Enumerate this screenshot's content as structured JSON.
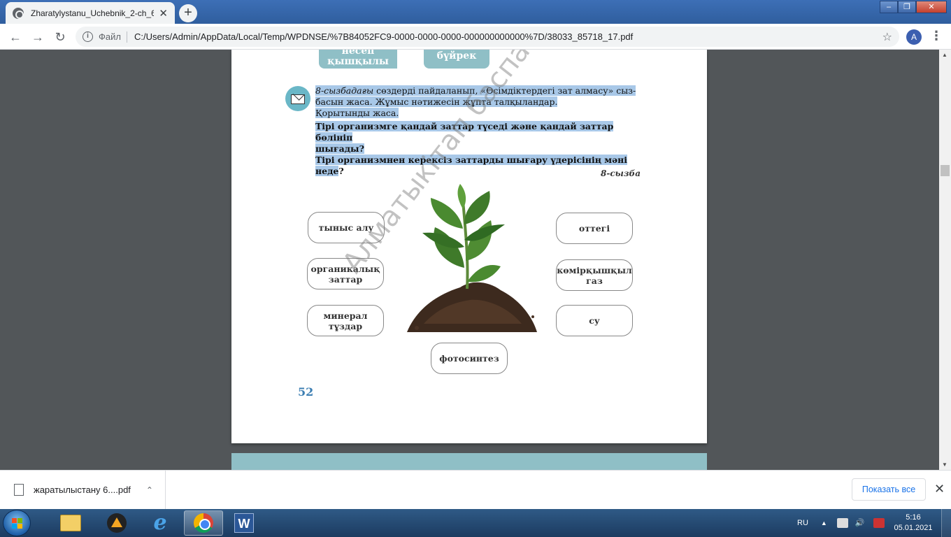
{
  "browser": {
    "tab_title": "Zharatylystanu_Uchebnik_2-ch_6",
    "tab_close": "✕",
    "new_tab": "+",
    "scheme_label": "Файл",
    "url": "C:/Users/Admin/AppData/Local/Temp/WPDNSE/%7B84052FC9-0000-0000-0000-000000000000%7D/38033_85718_17.pdf",
    "profile_initial": "A",
    "star_icon": "☆",
    "menu_icon": "⋮",
    "back_icon": "←",
    "forward_icon": "→",
    "reload_icon": "↻"
  },
  "page": {
    "chips": [
      {
        "label": "несеп\nқышқылы"
      },
      {
        "label": "бүйрек"
      }
    ],
    "task": {
      "line1_italic": "8-сызбадағы",
      "line1_rest": " сөздерді пайдаланып, «Өсімдіктердегі зат алмасу» сыз-",
      "line2": "басын жаса. Жұмыс нәтижесін жұпта талқыландар.",
      "line3": "Қорытынды жаса.",
      "q1_a": "Тірі организмге қандай заттар түседі және қандай заттар бөлініп",
      "q1_b": "шығады?",
      "q2": "Тірі организмнен керексіз заттарды шығару үдерісінің мәні неде",
      "q2_mark": "?"
    },
    "caption": "8-сызба",
    "diagram": {
      "left": [
        "тыныс алу",
        "органикалық\nзаттар",
        "минерал\nтұздар"
      ],
      "right": [
        "оттегі",
        "көмірқышқыл\nгаз",
        "су"
      ],
      "bottom": "фотосинтез"
    },
    "page_number": "52",
    "watermark": "Алматыкітап баспасы"
  },
  "downloads": {
    "file_name": "жаратылыстану 6....pdf",
    "chevron": "⌃",
    "show_all": "Показать все",
    "close": "✕"
  },
  "taskbar": {
    "lang": "RU",
    "time": "5:16",
    "date": "05.01.2021"
  }
}
